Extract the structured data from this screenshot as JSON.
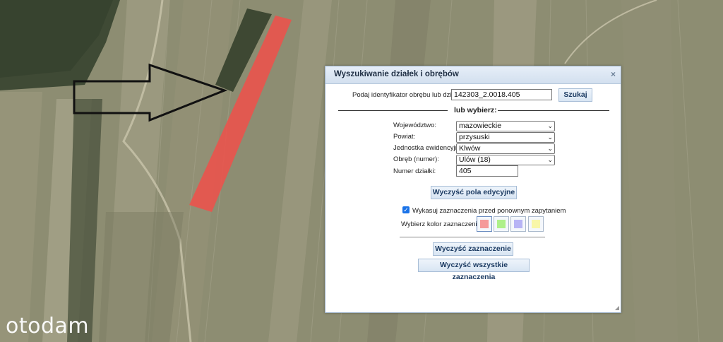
{
  "dialog": {
    "title": "Wyszukiwanie działek i obrębów",
    "close_symbol": "×",
    "identifier_label": "Podaj identyfikator obrębu lub działki:",
    "identifier_value": "142303_2.0018.405",
    "search_button": "Szukaj",
    "or_choose": "lub wybierz:",
    "fields": {
      "wojewodztwo_label": "Województwo:",
      "wojewodztwo_value": "mazowieckie",
      "powiat_label": "Powiat:",
      "powiat_value": "przysuski",
      "jednostka_label": "Jednostka ewidencyjna:",
      "jednostka_value": "Klwów",
      "obreb_label": "Obręb (numer):",
      "obreb_value": "Ulów (18)",
      "numer_label": "Numer działki:",
      "numer_value": "405"
    },
    "clear_fields_button": "Wyczyść pola edycyjne",
    "clear_before_label": "Wykasuj zaznaczenia przed ponownym zapytaniem",
    "clear_before_checked": true,
    "color_label": "Wybierz kolor zaznaczenia:",
    "colors": [
      "#f59a9a",
      "#aef08a",
      "#b7b4f5",
      "#f8f6a8"
    ],
    "clear_selection_button": "Wyczyść zaznaczenie",
    "clear_all_button": "Wyczyść wszystkie zaznaczenia"
  },
  "watermark": "otodam",
  "icons": {
    "close": "close-icon",
    "chevron": "chevron-down-icon",
    "resize": "resize-grip-icon",
    "arrow": "arrow-right-icon"
  },
  "accent": "#1a73e8",
  "highlight_color": "#f0504a"
}
